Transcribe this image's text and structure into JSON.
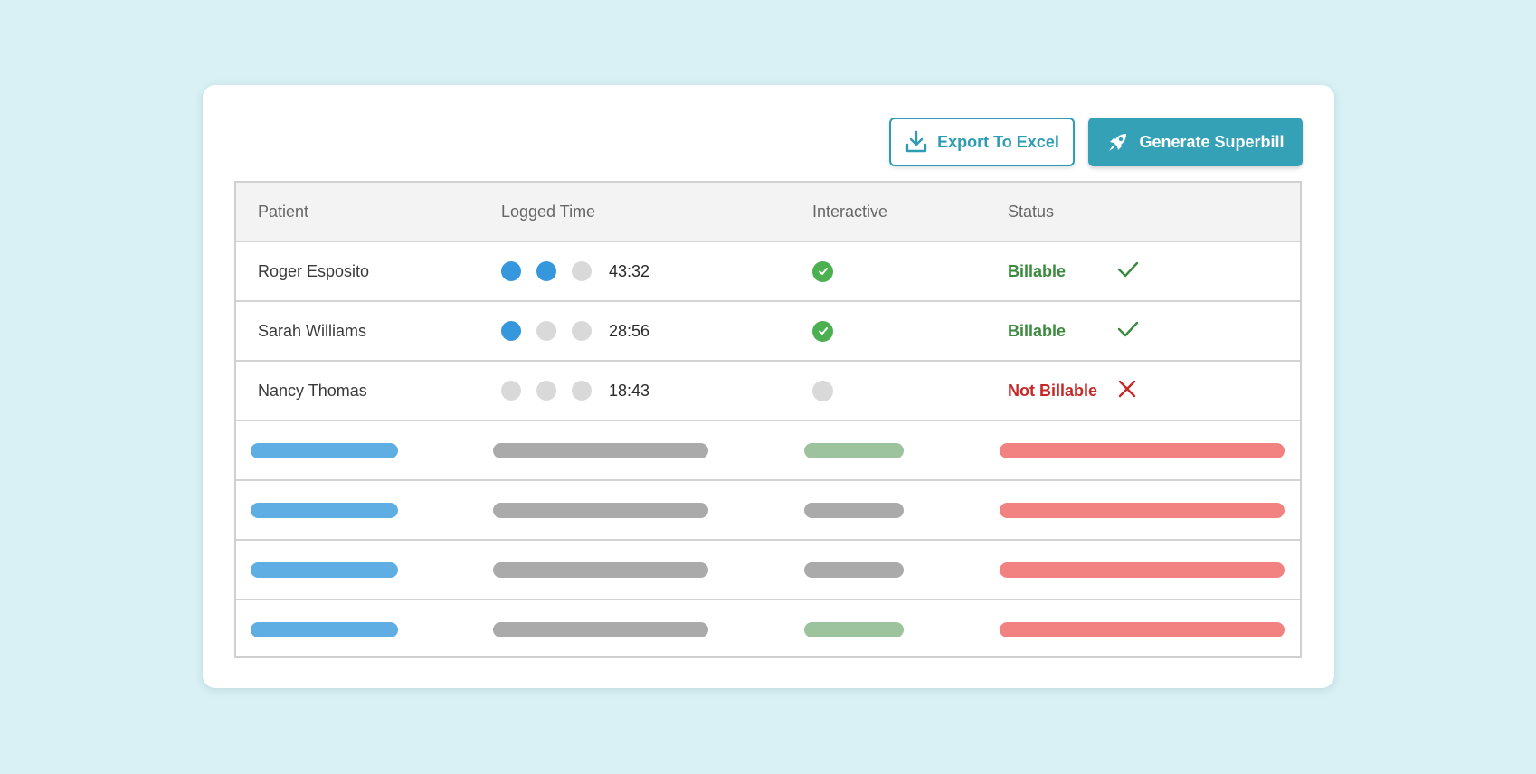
{
  "toolbar": {
    "export_label": "Export To Excel",
    "generate_label": "Generate Superbill"
  },
  "table": {
    "headers": [
      "Patient",
      "Logged Time",
      "Interactive",
      "Status"
    ],
    "rows": [
      {
        "patient": "Roger Esposito",
        "dots_filled": 2,
        "time": "43:32",
        "interactive": true,
        "status": "Billable",
        "billable": true
      },
      {
        "patient": "Sarah Williams",
        "dots_filled": 1,
        "time": "28:56",
        "interactive": true,
        "status": "Billable",
        "billable": true
      },
      {
        "patient": "Nancy Thomas",
        "dots_filled": 0,
        "time": "18:43",
        "interactive": false,
        "status": "Not Billable",
        "billable": false
      }
    ],
    "placeholder_rows": [
      {
        "interactive_color": "green"
      },
      {
        "interactive_color": "grey"
      },
      {
        "interactive_color": "grey"
      },
      {
        "interactive_color": "green"
      }
    ]
  },
  "colors": {
    "accent": "#34a1b7",
    "dot_active": "#3797dd",
    "billable": "#3b8a3e",
    "not_billable": "#c62828",
    "interactive_check": "#4caf50"
  },
  "icons": {
    "export": "download-icon",
    "generate": "rocket-icon",
    "billable": "check-icon",
    "not_billable": "close-icon"
  }
}
